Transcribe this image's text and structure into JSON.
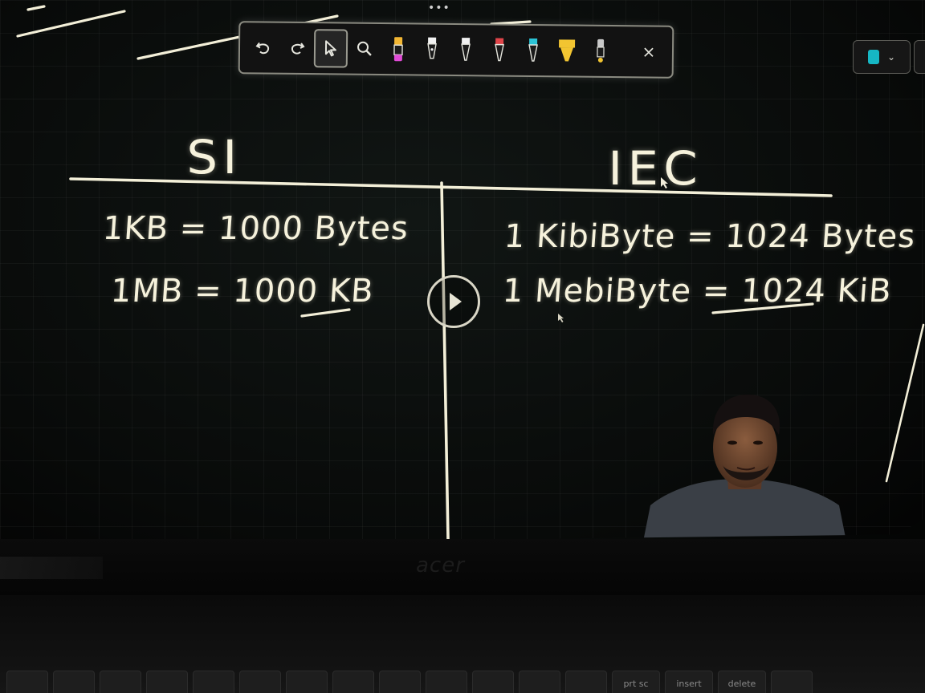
{
  "toolbar": {
    "undo_icon": "undo-icon",
    "redo_icon": "redo-icon",
    "select_icon": "cursor-arrow-icon",
    "zoom_icon": "magnifier-icon",
    "pens": [
      {
        "name": "pink-highlighter",
        "color": "#e04bd6"
      },
      {
        "name": "white-pen",
        "color": "#f2f2f2"
      },
      {
        "name": "white-pen-2",
        "color": "#f2f2f2"
      },
      {
        "name": "red-pen",
        "color": "#e0454a"
      },
      {
        "name": "cyan-pen",
        "color": "#2bc3d6"
      },
      {
        "name": "yellow-highlighter",
        "color": "#f2c531"
      },
      {
        "name": "eraser",
        "color": "#c9c9c9"
      }
    ],
    "close_label": "×"
  },
  "top_dots": "•••",
  "side_widget": {
    "swatch_color": "#16b7c4",
    "chevron": "⌄"
  },
  "board": {
    "left_heading": "SI",
    "right_heading": "IEC",
    "left_lines": [
      "1KB = 1000 Bytes",
      "1MB = 1000 KB"
    ],
    "right_lines": [
      "1 KibiByte = 1024 Bytes",
      "1 MebiByte = 1024 KiB"
    ]
  },
  "brand": "acer",
  "keys": [
    "",
    "",
    "",
    "",
    "",
    "",
    "",
    "",
    "",
    "",
    "",
    "",
    "",
    "prt sc",
    "insert",
    "delete",
    ""
  ]
}
